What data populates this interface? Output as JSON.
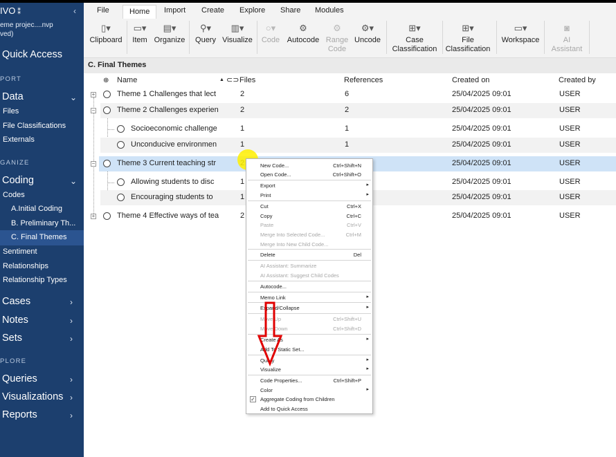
{
  "sidebar": {
    "title": "IVO",
    "project": [
      "eme projec....nvp",
      "ved)"
    ],
    "quick_access": "Quick Access",
    "section_import": "PORT",
    "data": "Data",
    "data_items": [
      "Files",
      "File Classifications",
      "Externals"
    ],
    "section_organize": "GANIZE",
    "coding": "Coding",
    "codes": "Codes",
    "code_items": [
      "A.Initial Coding",
      "B. Preliminary Th...",
      "C. Final Themes"
    ],
    "sentiment": "Sentiment",
    "relationships": "Relationships",
    "relationship_types": "Relationship Types",
    "cases": "Cases",
    "notes": "Notes",
    "sets": "Sets",
    "section_explore": "PLORE",
    "queries": "Queries",
    "visualizations": "Visualizations",
    "reports": "Reports"
  },
  "ribbon": {
    "tabs": [
      "File",
      "Home",
      "Import",
      "Create",
      "Explore",
      "Share",
      "Modules"
    ],
    "active_tab": "Home",
    "buttons": {
      "clipboard": "Clipboard",
      "item": "Item",
      "organize": "Organize",
      "query": "Query",
      "visualize": "Visualize",
      "code": "Code",
      "autocode": "Autocode",
      "range_code": [
        "Range",
        "Code"
      ],
      "uncode": "Uncode",
      "case_classification": [
        "Case",
        "Classification"
      ],
      "file_classification": [
        "File",
        "Classification"
      ],
      "workspace": "Workspace",
      "ai_assistant": [
        "AI",
        "Assistant"
      ]
    }
  },
  "content": {
    "title": "C. Final Themes",
    "columns": [
      "Name",
      "Files",
      "References",
      "Created on",
      "Created by"
    ],
    "rows": [
      {
        "name": "Theme 1 Challenges that lect",
        "files": "2",
        "refs": "6",
        "created_on": "25/04/2025 09:01",
        "created_by": "USER"
      },
      {
        "name": "Theme 2 Challenges experien",
        "files": "2",
        "refs": "2",
        "created_on": "25/04/2025 09:01",
        "created_by": "USER"
      },
      {
        "name": "Socioeconomic challenge",
        "files": "1",
        "refs": "1",
        "created_on": "25/04/2025 09:01",
        "created_by": "USER"
      },
      {
        "name": "Unconducive environmen",
        "files": "1",
        "refs": "1",
        "created_on": "25/04/2025 09:01",
        "created_by": "USER"
      },
      {
        "name": "Theme 3 Current teaching str",
        "files": "2",
        "refs": "",
        "created_on": "25/04/2025 09:01",
        "created_by": "USER"
      },
      {
        "name": "Allowing students to disc",
        "files": "1",
        "refs": "",
        "created_on": "25/04/2025 09:01",
        "created_by": "USER"
      },
      {
        "name": "Encouraging students to",
        "files": "1",
        "refs": "",
        "created_on": "25/04/2025 09:01",
        "created_by": "USER"
      },
      {
        "name": "Theme 4 Effective ways of tea",
        "files": "2",
        "refs": "",
        "created_on": "25/04/2025 09:01",
        "created_by": "USER"
      }
    ]
  },
  "context_menu": {
    "new_code": "New Code...",
    "new_code_sc": "Ctrl+Shift+N",
    "open_code": "Open Code...",
    "open_code_sc": "Ctrl+Shift+O",
    "export": "Export",
    "print": "Print",
    "cut": "Cut",
    "cut_sc": "Ctrl+X",
    "copy": "Copy",
    "copy_sc": "Ctrl+C",
    "paste": "Paste",
    "paste_sc": "Ctrl+V",
    "merge_selected": "Merge Into Selected Code...",
    "merge_selected_sc": "Ctrl+M",
    "merge_new": "Merge Into New Child Code...",
    "delete": "Delete",
    "delete_sc": "Del",
    "ai_summarize": "AI Assistant: Summarize",
    "ai_suggest": "AI Assistant: Suggest Child Codes",
    "autocode": "Autocode...",
    "memo_link": "Memo Link",
    "expand_collapse": "Expand/Collapse",
    "move_up": "Move Up",
    "move_up_sc": "Ctrl+Shift+U",
    "move_down": "Move Down",
    "move_down_sc": "Ctrl+Shift+D",
    "create_as": "Create As",
    "add_static_set": "Add To Static Set...",
    "query": "Query",
    "visualize": "Visualize",
    "code_properties": "Code Properties...",
    "code_properties_sc": "Ctrl+Shift+P",
    "color": "Color",
    "aggregate": "Aggregate Coding from Children",
    "add_quick_access": "Add to Quick Access"
  },
  "colors": {
    "sidebar_bg": "#1c3f6e",
    "selected_row": "#cfe3f7",
    "annotation_arrow": "#e00000",
    "cursor_highlight": "#fff000"
  }
}
